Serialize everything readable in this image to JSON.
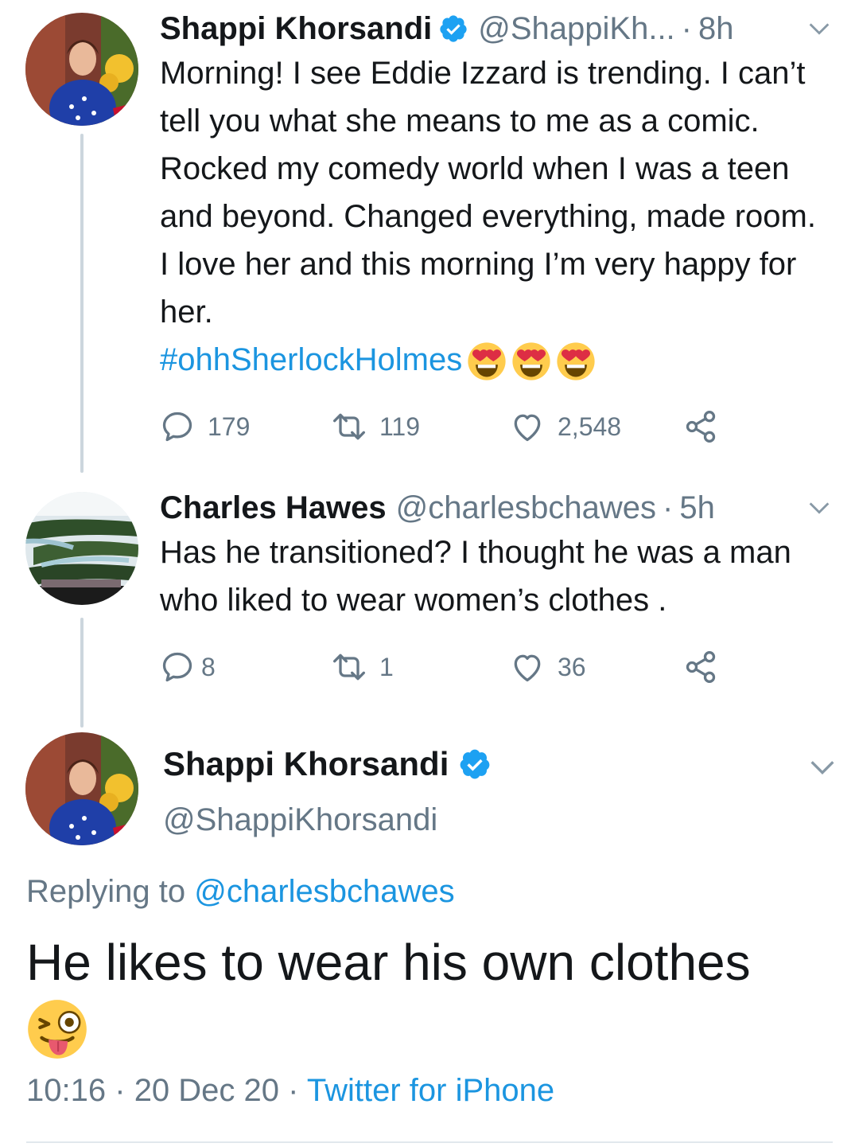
{
  "tweet1": {
    "name": "Shappi Khorsandi",
    "handle": "@ShappiKh...",
    "separator": "·",
    "time": "8h",
    "text": "Morning! I see Eddie Izzard is trending. I can’t tell you what she means to me as a comic. Rocked my comedy world when I was a teen and beyond. Changed everything, made room. I love her and this morning I’m very happy for her.",
    "hashtag": "#ohhSherlockHolmes",
    "emoji": "heart-eyes-emoji",
    "emoji_count": 3,
    "replies": "179",
    "retweets": "119",
    "likes": "2,548"
  },
  "tweet2": {
    "name": "Charles Hawes",
    "handle": "@charlesbchawes",
    "separator": "·",
    "time": "5h",
    "text": "Has he transitioned? I thought he was a man who liked to wear women’s clothes .",
    "replies": "8",
    "retweets": "1",
    "likes": "36"
  },
  "focused": {
    "name": "Shappi Khorsandi",
    "handle": "@ShappiKhorsandi",
    "replying_prefix": "Replying to",
    "replying_to": "@charlesbchawes",
    "text": "He likes to wear his own clothes",
    "emoji": "winking-tongue-emoji",
    "time": "10:16",
    "sep1": "·",
    "date": "20 Dec 20",
    "sep2": "·",
    "source": "Twitter for iPhone"
  },
  "colors": {
    "link": "#1b95e0",
    "secondary_text": "#657786",
    "verified": "#1da1f2",
    "thread_line": "#ccd6dd"
  },
  "icons": {
    "reply": "reply-icon",
    "retweet": "retweet-icon",
    "like": "heart-icon",
    "share": "share-icon",
    "verified": "verified-badge-icon",
    "chevron": "chevron-down-icon"
  }
}
